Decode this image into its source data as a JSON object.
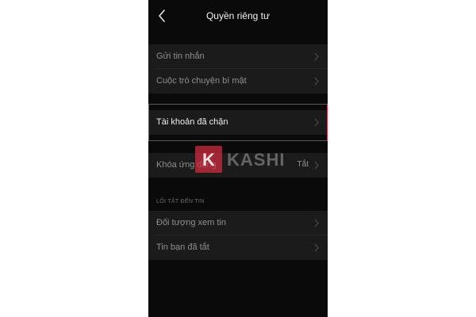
{
  "header": {
    "title": "Quyền riêng tư",
    "back_icon": "chevron-left-icon"
  },
  "section1": {
    "items": [
      {
        "label": "Gửi tin nhắn"
      },
      {
        "label": "Cuộc trò chuyện bí mật"
      }
    ]
  },
  "section2": {
    "items": [
      {
        "label": "Tài khoản đã chặn",
        "highlighted": true
      }
    ]
  },
  "section3": {
    "items": [
      {
        "label": "Khóa ứng dụng",
        "value": "Tắt"
      }
    ]
  },
  "section4": {
    "caption": "LỐI TẮT ĐẾN TIN",
    "items": [
      {
        "label": "Đối tượng xem tin"
      },
      {
        "label": "Tin bạn đã tắt"
      }
    ]
  },
  "watermark": {
    "letter": "K",
    "text": "KASHI"
  },
  "colors": {
    "background": "#0a0a0a",
    "row_background": "#1b1b1b",
    "highlight_border": "#d0243a",
    "watermark_red": "#d62d42"
  }
}
